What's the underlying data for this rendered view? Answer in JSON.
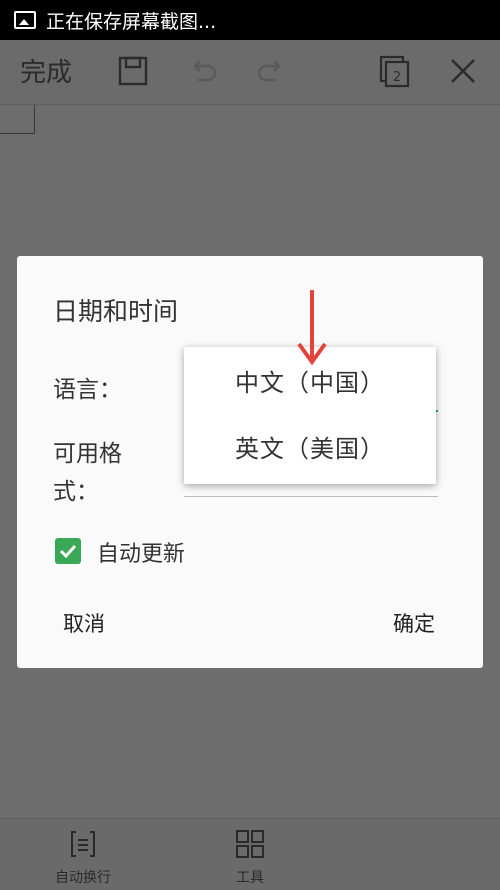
{
  "status_bar": {
    "text": "正在保存屏幕截图..."
  },
  "toolbar": {
    "done_label": "完成",
    "page_count": "2"
  },
  "bottom_bar": {
    "items": [
      {
        "label": "自动换行",
        "icon": "wrap-icon"
      },
      {
        "label": "工具",
        "icon": "grid-icon"
      }
    ]
  },
  "dialog": {
    "title": "日期和时间",
    "language_label": "语言：",
    "format_label_line1": "可用格",
    "format_label_line2": "式：",
    "auto_update_label": "自动更新",
    "auto_update_checked": true,
    "cancel_label": "取消",
    "confirm_label": "确定"
  },
  "dropdown": {
    "options": [
      "中文（中国）",
      "英文（美国）"
    ]
  },
  "colors": {
    "accent_line": "#1aa3a3",
    "checkbox": "#3aa856",
    "arrow": "#e0443a",
    "overlay": "#6d6d6d"
  }
}
